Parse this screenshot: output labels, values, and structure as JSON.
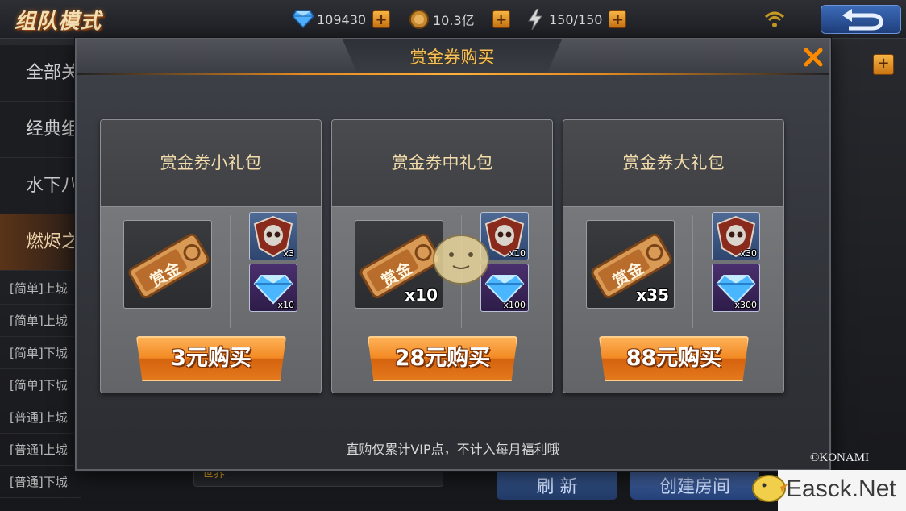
{
  "topbar": {
    "mode_title": "组队模式",
    "diamonds": "109430",
    "gold": "10.3亿",
    "stamina_current": "150",
    "stamina_max": "/150"
  },
  "left_menu": {
    "items": [
      "全部关",
      "经典组",
      "水下八",
      "燃烬之"
    ]
  },
  "room_list": {
    "rows": [
      "[简单]上城",
      "[简单]上城",
      "[简单]下城",
      "[简单]下城",
      "[普通]上城",
      "[普通]上城",
      "[普通]下城"
    ]
  },
  "dialog": {
    "title": "赏金券购买",
    "notice": "直购仅累计VIP点，不计入每月福利哦",
    "packs": [
      {
        "title": "赏金券小礼包",
        "ticket_count": "",
        "skull_qty": "x3",
        "gem_qty": "x10",
        "buy_label": "3元购买"
      },
      {
        "title": "赏金券中礼包",
        "ticket_count": "x10",
        "skull_qty": "x10",
        "gem_qty": "x100",
        "buy_label": "28元购买"
      },
      {
        "title": "赏金券大礼包",
        "ticket_count": "x35",
        "skull_qty": "x30",
        "gem_qty": "x300",
        "buy_label": "88元购买"
      }
    ],
    "ticket_label": "赏金"
  },
  "background_buttons": {
    "refresh": "刷 新",
    "create_room": "创建房间",
    "chat_tag": "世界"
  },
  "copyright": "©KONAMI",
  "watermark": "Easck.Net",
  "colors": {
    "accent_orange": "#f28a24",
    "title_gold": "#f5c25a",
    "stamina_green": "#7be05a",
    "close_orange": "#ff8a00"
  },
  "icons": {
    "diamond": "diamond-icon",
    "gold": "gold-coin-icon",
    "stamina": "lightning-icon",
    "skull": "skull-badge-icon",
    "gem": "gem-icon",
    "close": "close-icon"
  }
}
